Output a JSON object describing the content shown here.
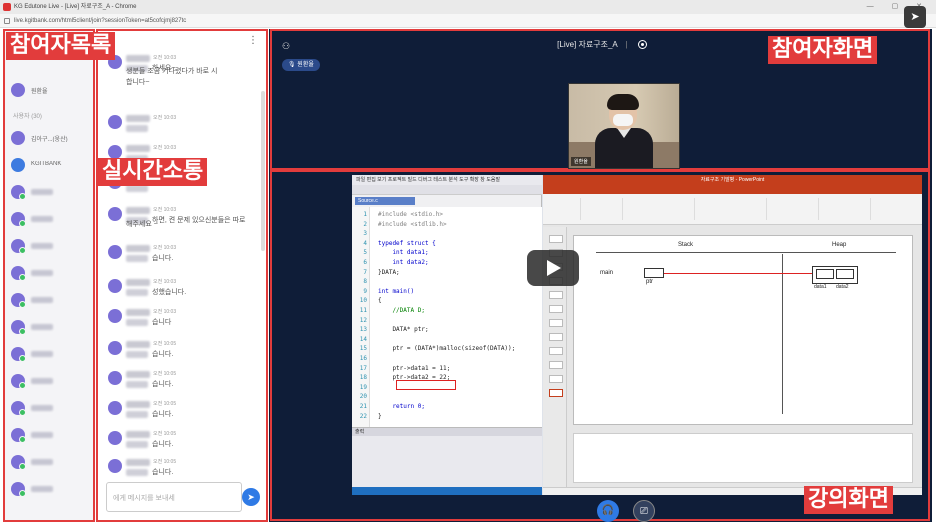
{
  "window": {
    "title": "KG Edutone Live - [Live] 자료구조_A - Chrome",
    "url": "live.kgitbank.com/html5client/join?sessionToken=at5cofcjmj827tc"
  },
  "overlays": {
    "participants": "참여자목록",
    "chat": "실시간소통",
    "participant_view": "참여자화면",
    "lecture_view": "강의화면"
  },
  "participants": {
    "moderator_label": "원환율",
    "section_label": "사용자 (30)",
    "items": [
      {
        "name": "김아구...(웅산)",
        "color": "#7b6fd6"
      },
      {
        "name": "KGITBANK",
        "color": "#3d7be0"
      },
      {
        "name": "",
        "color": "#7b6fd6"
      },
      {
        "name": "",
        "color": "#7b6fd6"
      },
      {
        "name": "",
        "color": "#7b6fd6"
      },
      {
        "name": "",
        "color": "#7b6fd6"
      },
      {
        "name": "",
        "color": "#7b6fd6"
      },
      {
        "name": "",
        "color": "#7b6fd6"
      },
      {
        "name": "",
        "color": "#7b6fd6"
      },
      {
        "name": "",
        "color": "#7b6fd6"
      },
      {
        "name": "",
        "color": "#7b6fd6"
      },
      {
        "name": "",
        "color": "#7b6fd6"
      },
      {
        "name": "",
        "color": "#7b6fd6"
      },
      {
        "name": "",
        "color": "#7b6fd6"
      }
    ]
  },
  "chat": {
    "messages": [
      {
        "time": "오전 10:03",
        "text": "하세요~"
      },
      {
        "time": "",
        "text": "생분들 조금 기다렸다가 바로 시"
      },
      {
        "time": "",
        "text": "합니다~"
      },
      {
        "time": "오전 10:03",
        "text": ""
      },
      {
        "time": "오전 10:03",
        "text": ""
      },
      {
        "time": "오전 10:03",
        "text": ""
      },
      {
        "time": "오전 10:03",
        "text": "하면, 켠 문제 있으신분들은 따로"
      },
      {
        "time": "",
        "text": "해주세요 ~"
      },
      {
        "time": "오전 10:03",
        "text": "습니다."
      },
      {
        "time": "오전 10:03",
        "text": "성했습니다."
      },
      {
        "time": "오전 10:03",
        "text": "습니다"
      },
      {
        "time": "오전 10:05",
        "text": "습니다."
      },
      {
        "time": "오전 10:05",
        "text": "습니다."
      },
      {
        "time": "오전 10:05",
        "text": "습니다."
      },
      {
        "time": "오전 10:05",
        "text": "습니다."
      },
      {
        "time": "오전 10:05",
        "text": "습니다."
      }
    ],
    "input_placeholder": "에게 메시지를 보내세"
  },
  "main": {
    "session_title": "[Live] 자료구조_A",
    "presenter_badge": "원환율",
    "cam_label": "원환율"
  },
  "lecture": {
    "vs_menu": "파일 편집 보기 프로젝트 빌드 디버그 테스트 분석 도구 확장 창 도움말",
    "vs_tab": "Source.c",
    "vs_output_title": "출력",
    "code_lines": [
      {
        "n": "1",
        "t": "#include <stdio.h>"
      },
      {
        "n": "2",
        "t": "#include <stdlib.h>"
      },
      {
        "n": "3",
        "t": ""
      },
      {
        "n": "4",
        "t": "typedef struct {"
      },
      {
        "n": "5",
        "t": "    int data1;"
      },
      {
        "n": "6",
        "t": "    int data2;"
      },
      {
        "n": "7",
        "t": "}DATA;"
      },
      {
        "n": "8",
        "t": ""
      },
      {
        "n": "9",
        "t": "int main()"
      },
      {
        "n": "10",
        "t": "{"
      },
      {
        "n": "11",
        "t": "    //DATA D;"
      },
      {
        "n": "12",
        "t": ""
      },
      {
        "n": "13",
        "t": "    DATA* ptr;"
      },
      {
        "n": "14",
        "t": ""
      },
      {
        "n": "15",
        "t": "    ptr = (DATA*)malloc(sizeof(DATA));"
      },
      {
        "n": "16",
        "t": ""
      },
      {
        "n": "17",
        "t": "    ptr->data1 = 11;"
      },
      {
        "n": "18",
        "t": "    ptr->data2 = 22;"
      },
      {
        "n": "19",
        "t": ""
      },
      {
        "n": "20",
        "t": ""
      },
      {
        "n": "21",
        "t": "    return 0;"
      },
      {
        "n": "22",
        "t": "}"
      }
    ],
    "ppt_title": "자료구조 기말평 - PowerPoint",
    "slide": {
      "stack_label": "Stack",
      "heap_label": "Heap",
      "main_label": "main",
      "ptr_label": "ptr",
      "data1_label": "data1",
      "data2_label": "data2"
    }
  },
  "colors": {
    "highlight": "#e23c3c",
    "main_bg": "#0f1d38",
    "accent": "#2f7ae5"
  },
  "icons": {
    "share": "paper-plane-icon",
    "audio": "headset-icon",
    "video": "camera-icon",
    "send": "send-icon"
  }
}
